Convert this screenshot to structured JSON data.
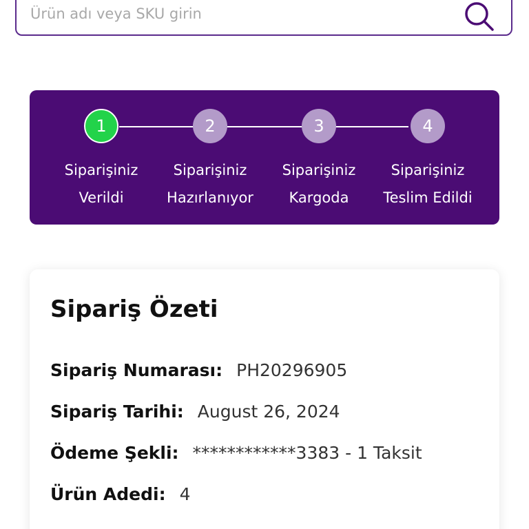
{
  "search": {
    "placeholder": "Ürün adı veya SKU girin",
    "value": ""
  },
  "order_status": {
    "steps": [
      {
        "number": "1",
        "label": "Siparişiniz\nVerildi",
        "active": true
      },
      {
        "number": "2",
        "label": "Siparişiniz\nHazırlanıyor",
        "active": false
      },
      {
        "number": "3",
        "label": "Siparişiniz\nKargoda",
        "active": false
      },
      {
        "number": "4",
        "label": "Siparişiniz\nTeslim Edildi",
        "active": false
      }
    ]
  },
  "summary": {
    "title": "Sipariş Özeti",
    "rows": [
      {
        "label": "Sipariş Numarası:",
        "value": "PH20296905"
      },
      {
        "label": "Sipariş Tarihi:",
        "value": "August 26, 2024"
      },
      {
        "label": "Ödeme Şekli:",
        "value": "************3383 - 1 Taksit"
      },
      {
        "label": "Ürün Adedi:",
        "value": "4"
      }
    ]
  },
  "colors": {
    "brand_purple": "#4b0c74",
    "active_step": "#22d34a",
    "inactive_step": "#b39bc9",
    "search_border": "#5a2a8c"
  },
  "icons": {
    "search": "search-icon"
  }
}
